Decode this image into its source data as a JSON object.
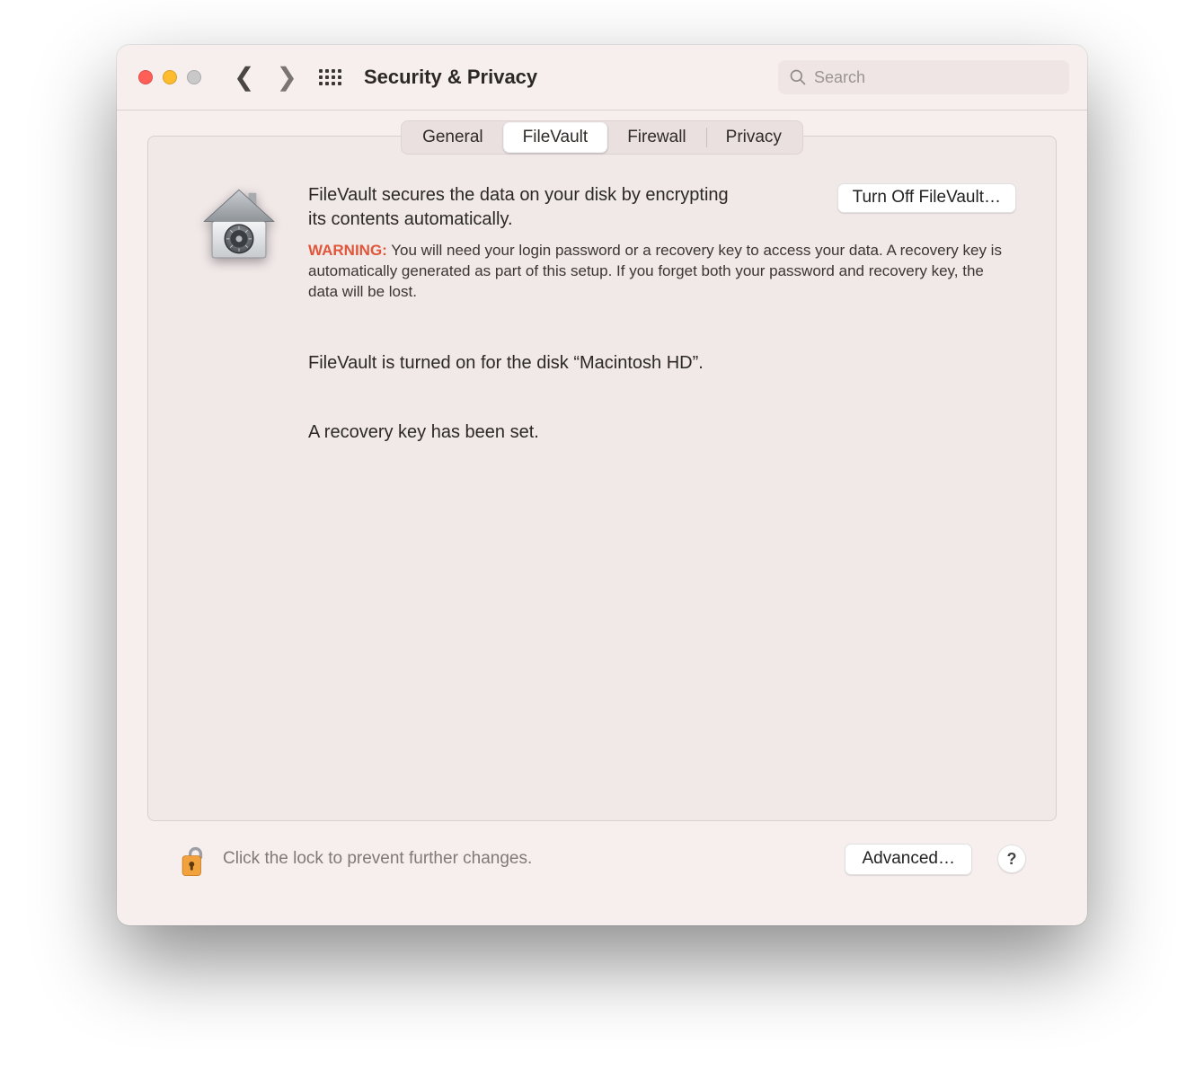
{
  "window": {
    "title": "Security & Privacy"
  },
  "search": {
    "placeholder": "Search",
    "value": ""
  },
  "tabs": {
    "items": [
      "General",
      "FileVault",
      "Firewall",
      "Privacy"
    ],
    "active_index": 1
  },
  "filevault": {
    "intro": "FileVault secures the data on your disk by encrypting its contents automatically.",
    "turn_off_label": "Turn Off FileVault…",
    "warning_label": "WARNING:",
    "warning_text": "You will need your login password or a recovery key to access your data. A recovery key is automatically generated as part of this setup. If you forget both your password and recovery key, the data will be lost.",
    "status_disk": "FileVault is turned on for the disk “Macintosh HD”.",
    "status_recovery": "A recovery key has been set."
  },
  "footer": {
    "lock_text": "Click the lock to prevent further changes.",
    "advanced_label": "Advanced…",
    "help_label": "?"
  },
  "colors": {
    "window_bg": "#f7eeee",
    "panel_bg": "#f1e8e8",
    "warning": "#e0563a"
  }
}
